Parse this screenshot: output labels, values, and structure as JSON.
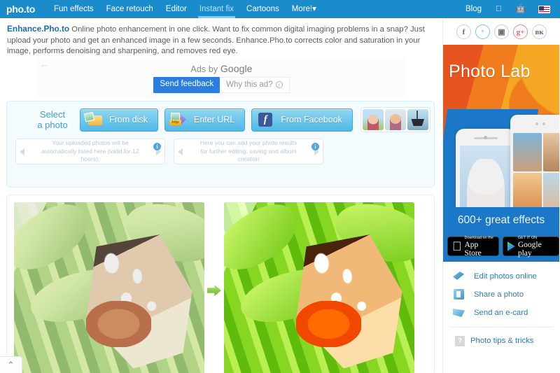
{
  "header": {
    "logo": "pho.to",
    "nav": [
      {
        "label": "Fun effects",
        "active": false
      },
      {
        "label": "Face retouch",
        "active": false
      },
      {
        "label": "Editor",
        "active": false
      },
      {
        "label": "Instant fix",
        "active": true
      },
      {
        "label": "Cartoons",
        "active": false
      },
      {
        "label": "More!",
        "active": false
      }
    ],
    "nav_more_label": "More!",
    "blog_label": "Blog",
    "icons": [
      "apple-icon",
      "android-icon",
      "us-flag-icon"
    ]
  },
  "intro": {
    "title": "Enhance.Pho.to",
    "text": "Online photo enhancement in one click. Want to fix common digital imaging problems in a snap? Just upload your photo and get an enhanced image in a few seconds. Enhance.Pho.to corrects color and saturation in your image, performs denoising and sharpening, and removes red eye."
  },
  "ad": {
    "ads_by_prefix": "Ads by ",
    "ads_by_brand": "Google",
    "send_feedback": "Send feedback",
    "why_this_ad": "Why this ad?",
    "back_arrow": "←"
  },
  "select_photo": {
    "label_line1": "Select",
    "label_line2": "a photo",
    "buttons": [
      {
        "label": "From disk",
        "icon": "folder-photo-icon"
      },
      {
        "label": "Enter URL",
        "icon": "url-arrow-icon"
      },
      {
        "label": "From Facebook",
        "icon": "facebook-icon"
      }
    ],
    "samples": [
      "sample-woman",
      "sample-man",
      "sample-boat"
    ],
    "info_boxes": [
      {
        "text": "Your uploaded photos will be automatically listed here (valid for 12 hours)."
      },
      {
        "text": "Here you can add your photo results for further editing, saving and album creation"
      }
    ]
  },
  "result": {
    "before_alt": "butterfly-before",
    "after_alt": "butterfly-after",
    "arrow": "green-arrow-icon"
  },
  "scroll_top": {
    "glyph": "⌃"
  },
  "sidebar": {
    "social": [
      {
        "name": "facebook",
        "glyph": "f"
      },
      {
        "name": "twitter",
        "glyph": "ᵛ"
      },
      {
        "name": "instagram",
        "glyph": "▣"
      },
      {
        "name": "googleplus",
        "glyph": "g+"
      },
      {
        "name": "vkontakte",
        "glyph": "вк"
      }
    ],
    "banner": {
      "title": "Photo Lab",
      "effects": "600+ great effects",
      "appstore_small": "Download on the",
      "appstore_big": "App Store",
      "play_small": "GET IT ON",
      "play_big": "Google play"
    },
    "links": [
      {
        "label": "Edit photos online",
        "icon": "edit-icon"
      },
      {
        "label": "Share a photo",
        "icon": "share-icon"
      },
      {
        "label": "Send an e-card",
        "icon": "ecard-icon"
      },
      {
        "label": "Photo tips & tricks",
        "icon": "tips-icon"
      }
    ]
  },
  "colors": {
    "header_blue": "#1a8ccc",
    "panel_blue": "#f3fbfe",
    "link_blue": "#2f7bb0",
    "accent_button": "#2b7de0"
  }
}
